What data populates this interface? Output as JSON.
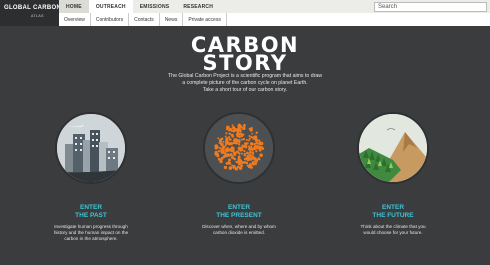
{
  "logo": {
    "text": "GLOBAL CARBON",
    "sub": "ATLAS"
  },
  "nav": {
    "items": [
      {
        "label": "HOME"
      },
      {
        "label": "OUTREACH"
      },
      {
        "label": "EMISSIONS"
      },
      {
        "label": "RESEARCH"
      }
    ],
    "sub_items": [
      {
        "label": "Overview"
      },
      {
        "label": "Contributors"
      },
      {
        "label": "Contacts"
      },
      {
        "label": "News"
      },
      {
        "label": "Private access"
      }
    ]
  },
  "search": {
    "placeholder": "Search"
  },
  "hero": {
    "title_line1": "CARBON",
    "title_line2": "STORY",
    "intro_line1": "The Global Carbon Project is a scientific program that aims to draw",
    "intro_line2": "a complete picture of the carbon cycle on planet Earth.",
    "intro_line3": "Take a short tour of our carbon story."
  },
  "sections": [
    {
      "enter": "ENTER",
      "title": "THE PAST",
      "desc1": "Investigate human progress through",
      "desc2": "history and the human impact on the",
      "desc3": "carbon in the atmosphere."
    },
    {
      "enter": "ENTER",
      "title": "THE PRESENT",
      "desc1": "Discover when, where and by whom",
      "desc2": "carbon dioxide is emitted.",
      "desc3": ""
    },
    {
      "enter": "ENTER",
      "title": "THE FUTURE",
      "desc1": "Think about the climate that you",
      "desc2": "would choose for your future.",
      "desc3": ""
    }
  ],
  "colors": {
    "accent": "#3ec5d6",
    "background": "#3b3c3e",
    "dots": "#f07a1e"
  }
}
